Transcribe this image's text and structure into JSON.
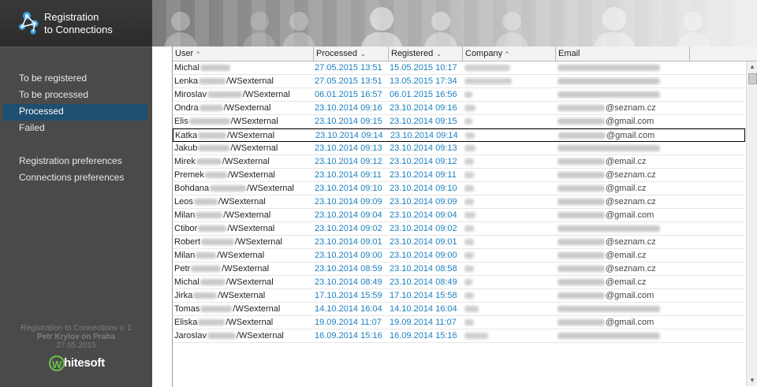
{
  "app": {
    "title_line1": "Registration",
    "title_line2": "to Connections",
    "logo_icon": "network-nodes-icon"
  },
  "sidebar": {
    "items": [
      {
        "label": "To be registered",
        "active": false
      },
      {
        "label": "To be processed",
        "active": false
      },
      {
        "label": "Processed",
        "active": true
      },
      {
        "label": "Failed",
        "active": false
      }
    ],
    "preferences": [
      {
        "label": "Registration preferences"
      },
      {
        "label": "Connections preferences"
      }
    ],
    "about": {
      "version": "Registration to Connections v. 1",
      "author": "Petr Krylov on Praha",
      "date": "27.05.2015"
    },
    "company_logo": "Whitesoft"
  },
  "table": {
    "columns": [
      {
        "label": "User",
        "sort": "asc"
      },
      {
        "label": "Processed",
        "sort": "desc"
      },
      {
        "label": "Registered",
        "sort": "desc"
      },
      {
        "label": "Company",
        "sort": "asc"
      },
      {
        "label": "Email",
        "sort": ""
      }
    ],
    "rows": [
      {
        "user_first": "Michal",
        "user_suffix": "",
        "processed": "27.05.2015 13:51",
        "registered": "15.05.2015 10:17",
        "email_domain": ""
      },
      {
        "user_first": "Lenka",
        "user_suffix": "/WSexternal",
        "processed": "27.05.2015 13:51",
        "registered": "13.05.2015 17:34",
        "email_domain": ""
      },
      {
        "user_first": "Miroslav",
        "user_suffix": "/WSexternal",
        "processed": "06.01.2015 16:57",
        "registered": "06.01.2015 16:56",
        "email_domain": ""
      },
      {
        "user_first": "Ondra",
        "user_suffix": "/WSexternal",
        "processed": "23.10.2014 09:16",
        "registered": "23.10.2014 09:16",
        "email_domain": "@seznam.cz"
      },
      {
        "user_first": "Elis",
        "user_suffix": "/WSexternal",
        "processed": "23.10.2014 09:15",
        "registered": "23.10.2014 09:15",
        "email_domain": "@gmail.com"
      },
      {
        "user_first": "Katka",
        "user_suffix": "/WSexternal",
        "processed": "23.10.2014 09:14",
        "registered": "23.10.2014 09:14",
        "email_domain": "@gmail.com"
      },
      {
        "user_first": "Jakub",
        "user_suffix": "/WSexternal",
        "processed": "23.10.2014 09:13",
        "registered": "23.10.2014 09:13",
        "email_domain": ""
      },
      {
        "user_first": "Mirek",
        "user_suffix": "/WSexternal",
        "processed": "23.10.2014 09:12",
        "registered": "23.10.2014 09:12",
        "email_domain": "@email.cz"
      },
      {
        "user_first": "Premek",
        "user_suffix": "/WSexternal",
        "processed": "23.10.2014 09:11",
        "registered": "23.10.2014 09:11",
        "email_domain": "@seznam.cz"
      },
      {
        "user_first": "Bohdana",
        "user_suffix": "/WSexternal",
        "processed": "23.10.2014 09:10",
        "registered": "23.10.2014 09:10",
        "email_domain": "@gmail.cz"
      },
      {
        "user_first": "Leos",
        "user_suffix": "/WSexternal",
        "processed": "23.10.2014 09:09",
        "registered": "23.10.2014 09:09",
        "email_domain": "@seznam.cz"
      },
      {
        "user_first": "Milan",
        "user_suffix": "/WSexternal",
        "processed": "23.10.2014 09:04",
        "registered": "23.10.2014 09:04",
        "email_domain": "@gmail.com"
      },
      {
        "user_first": "Ctibor",
        "user_suffix": "/WSexternal",
        "processed": "23.10.2014 09:02",
        "registered": "23.10.2014 09:02",
        "email_domain": ""
      },
      {
        "user_first": "Robert",
        "user_suffix": "/WSexternal",
        "processed": "23.10.2014 09:01",
        "registered": "23.10.2014 09:01",
        "email_domain": "@seznam.cz"
      },
      {
        "user_first": "Milan",
        "user_suffix": "/WSexternal",
        "processed": "23.10.2014 09:00",
        "registered": "23.10.2014 09:00",
        "email_domain": "@email.cz"
      },
      {
        "user_first": "Petr",
        "user_suffix": "/WSexternal",
        "processed": "23.10.2014 08:59",
        "registered": "23.10.2014 08:58",
        "email_domain": "@seznam.cz"
      },
      {
        "user_first": "Michal",
        "user_suffix": "/WSexternal",
        "processed": "23.10.2014 08:49",
        "registered": "23.10.2014 08:49",
        "email_domain": "@email.cz"
      },
      {
        "user_first": "Jirka",
        "user_suffix": "/WSexternal",
        "processed": "17.10.2014 15:59",
        "registered": "17.10.2014 15:58",
        "email_domain": "@gmail.com"
      },
      {
        "user_first": "Tomas",
        "user_suffix": "/WSexternal",
        "processed": "14.10.2014 16:04",
        "registered": "14.10.2014 16:04",
        "email_domain": ""
      },
      {
        "user_first": "Eliska",
        "user_suffix": "/WSexternal",
        "processed": "19.09.2014 11:07",
        "registered": "19.09.2014 11:07",
        "email_domain": "@gmail.com"
      },
      {
        "user_first": "Jaroslav",
        "user_suffix": "/WSexternal",
        "processed": "16.09.2014 15:16",
        "registered": "16.09.2014 15:16",
        "email_domain": ""
      }
    ],
    "selected_row_index": 5
  },
  "colors": {
    "sidebar_bg": "#4a4a4a",
    "active_item_bg": "#1f4f70",
    "date_text": "#1a7fc0",
    "logo_accent": "#6ac24a"
  }
}
